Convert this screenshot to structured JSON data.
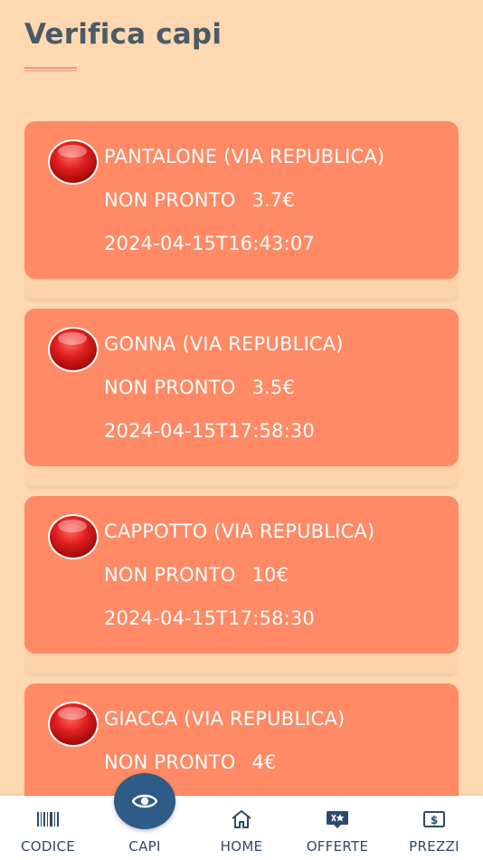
{
  "header": {
    "title": "Verifica capi"
  },
  "items": [
    {
      "name": "PANTALONE (VIA REPUBLICA)",
      "status": "NON PRONTO",
      "price": "3.7€",
      "timestamp": "2024-04-15T16:43:07",
      "status_color": "#e01e1e"
    },
    {
      "name": "GONNA (VIA REPUBLICA)",
      "status": "NON PRONTO",
      "price": "3.5€",
      "timestamp": "2024-04-15T17:58:30",
      "status_color": "#e01e1e"
    },
    {
      "name": "CAPPOTTO (VIA REPUBLICA)",
      "status": "NON PRONTO",
      "price": "10€",
      "timestamp": "2024-04-15T17:58:30",
      "status_color": "#e01e1e"
    },
    {
      "name": "GIACCA (VIA REPUBLICA)",
      "status": "NON PRONTO",
      "price": "4€",
      "timestamp": "",
      "status_color": "#e01e1e"
    }
  ],
  "nav": {
    "items": [
      {
        "label": "CODICE",
        "icon": "barcode-icon"
      },
      {
        "label": "CAPI",
        "icon": "eye-icon",
        "active": true
      },
      {
        "label": "HOME",
        "icon": "home-icon"
      },
      {
        "label": "OFFERTE",
        "icon": "offer-tag-icon"
      },
      {
        "label": "PREZZI",
        "icon": "price-tag-icon"
      }
    ]
  },
  "colors": {
    "background": "#fdd8b0",
    "card": "#ff8a65",
    "nav_active": "#2d5c86",
    "nav_text": "#2e4a6b",
    "title": "#4a5a66"
  }
}
